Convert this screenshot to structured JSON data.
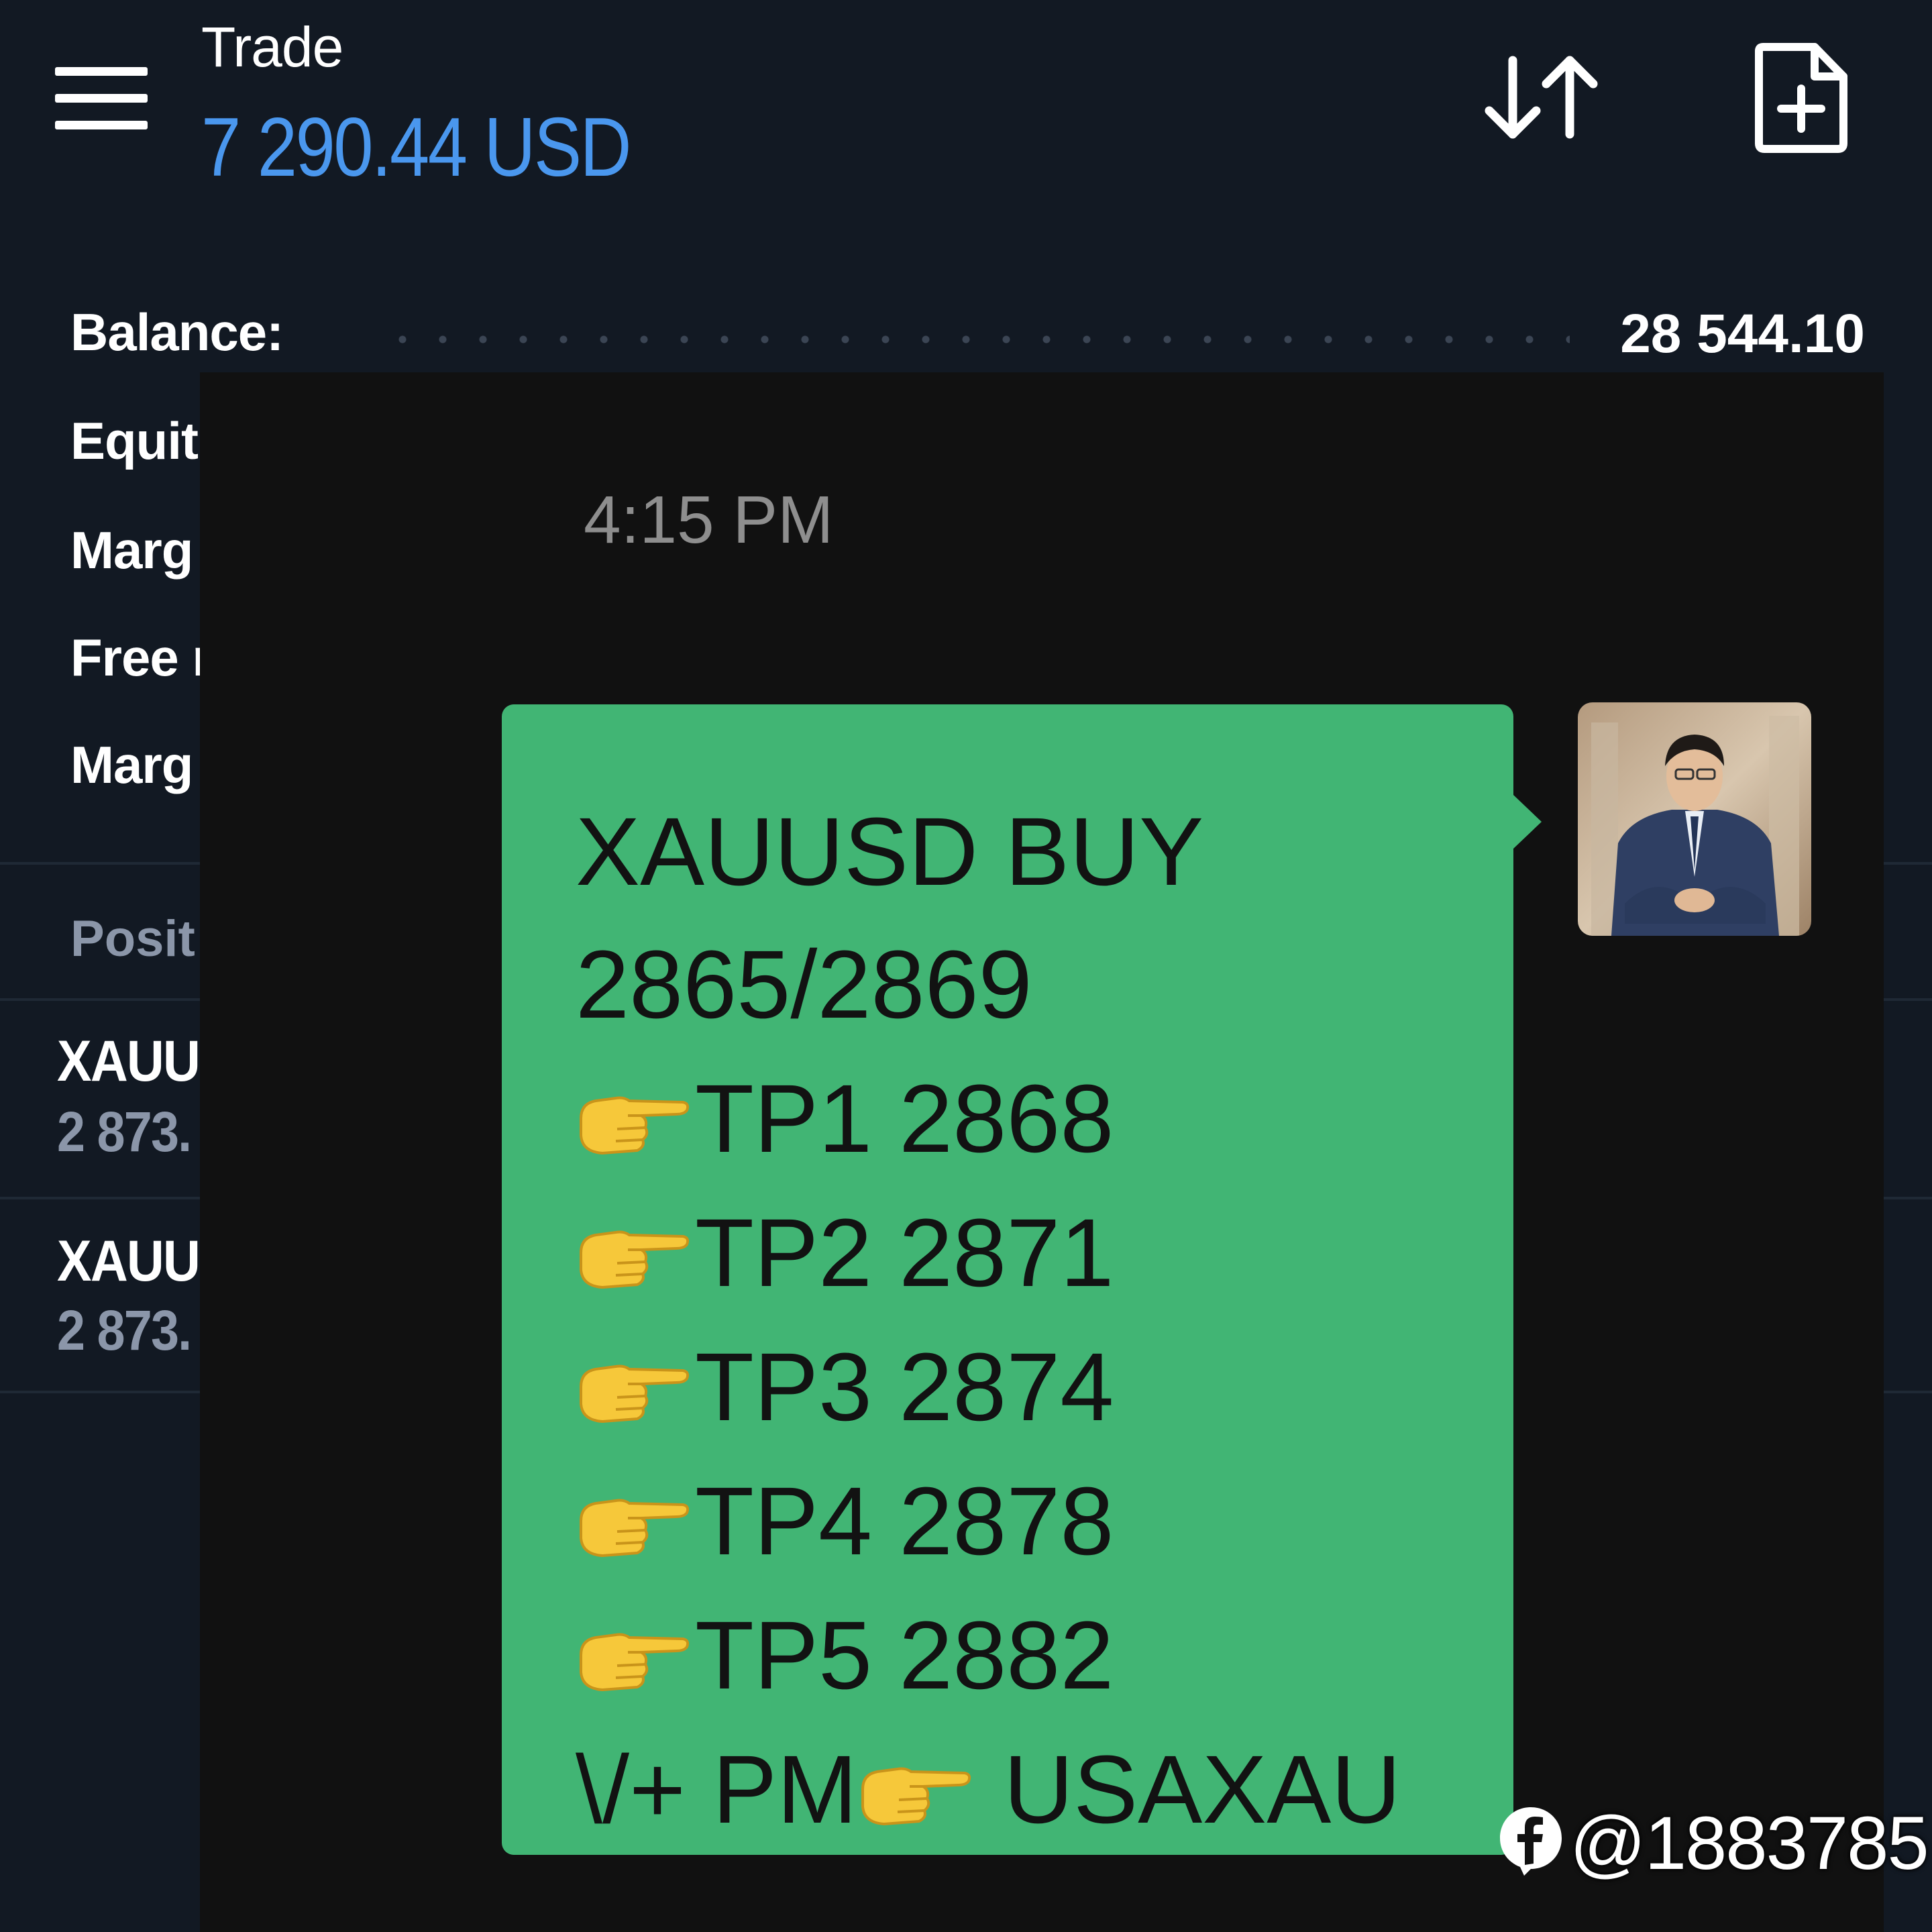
{
  "header": {
    "title": "Trade",
    "equity": "7 290.44 USD"
  },
  "summary": {
    "balance_label": "Balance:",
    "balance_value": "28 544.10",
    "equity_label": "Equit",
    "margin_label": "Marg",
    "free_margin_label": "Free m",
    "margin_level_label": "Marg"
  },
  "positions": {
    "header": "Posit",
    "items": [
      {
        "symbol": "XAUUS",
        "price": "2 873."
      },
      {
        "symbol": "XAUUS",
        "price": "2 873."
      }
    ]
  },
  "chat": {
    "timestamp": "4:15 PM",
    "message": {
      "line1": "XAUUSD BUY",
      "line2": "2865/2869",
      "tp1": "TP1 2868",
      "tp2": "TP2 2871",
      "tp3": "TP3 2874",
      "tp4": "TP4 2878",
      "tp5": "TP5 2882",
      "footer_a": "\\/+ PM",
      "footer_b": " USAXAU"
    },
    "bubble_color": "#41b574"
  },
  "watermark": {
    "handle": "@1883785",
    "icon": "facebook-icon"
  },
  "colors": {
    "app_background": "#121923",
    "accent_blue": "#4a97ee",
    "chat_background": "#111111",
    "muted_text": "#8b96a9"
  }
}
